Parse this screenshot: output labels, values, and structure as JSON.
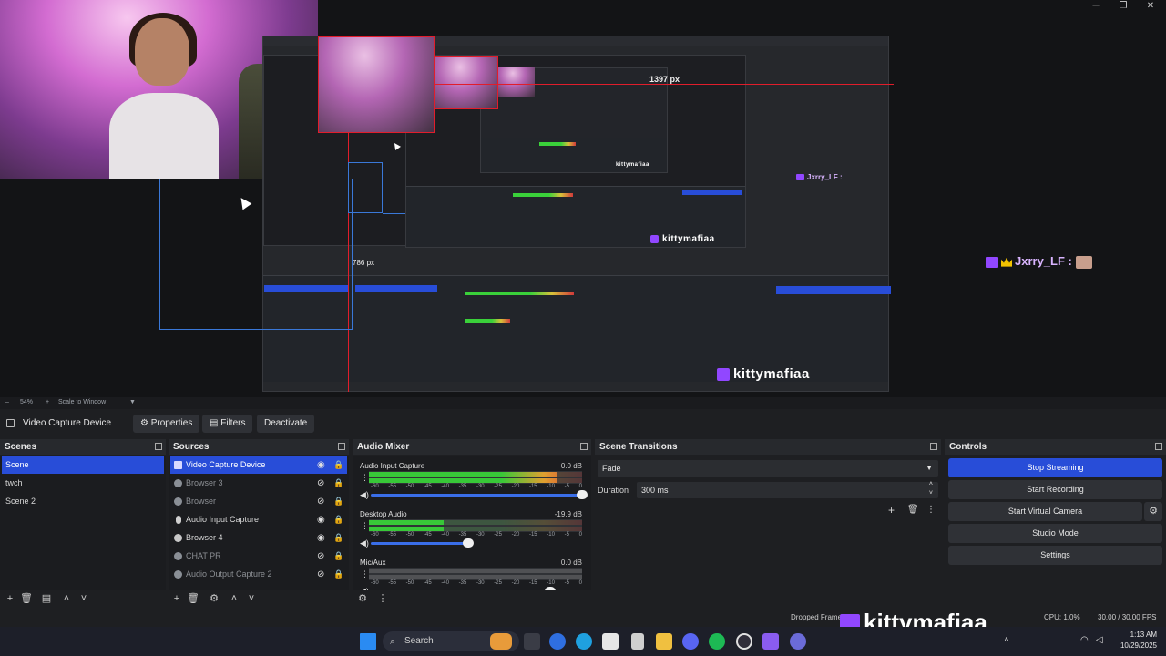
{
  "window_controls": {
    "minimize": "─",
    "maximize": "❐",
    "close": "✕"
  },
  "preview": {
    "px_label_width": "1397 px",
    "px_label_height": "786 px",
    "chat_user": "Jxrry_LF",
    "chat_colon": ":",
    "watermark": "kittymafiaa"
  },
  "zoombar": {
    "zoom": "54%",
    "scale_mode": "Scale to Window"
  },
  "source_toolbar": {
    "selected_source": "Video Capture Device",
    "properties": "Properties",
    "filters": "Filters",
    "deactivate": "Deactivate"
  },
  "scenes": {
    "title": "Scenes",
    "items": [
      "Scene",
      "twch",
      "Scene 2"
    ],
    "selected_index": 0
  },
  "sources": {
    "title": "Sources",
    "items": [
      {
        "label": "Video Capture Device",
        "visible": true
      },
      {
        "label": "Browser 3",
        "visible": false
      },
      {
        "label": "Browser",
        "visible": false
      },
      {
        "label": "Audio Input Capture",
        "visible": true
      },
      {
        "label": "Browser 4",
        "visible": true
      },
      {
        "label": "CHAT PR",
        "visible": false
      },
      {
        "label": "Audio Output Capture 2",
        "visible": false
      }
    ]
  },
  "mixer": {
    "title": "Audio Mixer",
    "channels": [
      {
        "name": "Audio Input Capture",
        "db": "0.0 dB",
        "level": 0.88,
        "volume": 1.0
      },
      {
        "name": "Desktop Audio",
        "db": "-19.9 dB",
        "level": 0.35,
        "volume": 0.46
      },
      {
        "name": "Mic/Aux",
        "db": "0.0 dB",
        "level": 0.0,
        "volume": 0.85
      }
    ],
    "scale": [
      "-60",
      "-55",
      "-50",
      "-45",
      "-40",
      "-35",
      "-30",
      "-25",
      "-20",
      "-15",
      "-10",
      "-5",
      "0"
    ]
  },
  "transitions": {
    "title": "Scene Transitions",
    "selected": "Fade",
    "duration_label": "Duration",
    "duration_value": "300 ms"
  },
  "controls": {
    "title": "Controls",
    "stop_streaming": "Stop Streaming",
    "start_recording": "Start Recording",
    "start_virtual_camera": "Start Virtual Camera",
    "studio_mode": "Studio Mode",
    "settings": "Settings"
  },
  "statusbar": {
    "dropped_frames": "Dropped Frames",
    "cpu": "CPU: 1.0%",
    "fps": "30.00 / 30.00 FPS"
  },
  "taskbar": {
    "search": "Search",
    "time": "1:13 AM",
    "date": "10/29/2025"
  },
  "colors": {
    "accent": "#284dd8",
    "preview_bg": "#131416",
    "red_guide": "#e11d2b",
    "blue_guide": "#3a78d8",
    "twitch": "#9147ff"
  }
}
